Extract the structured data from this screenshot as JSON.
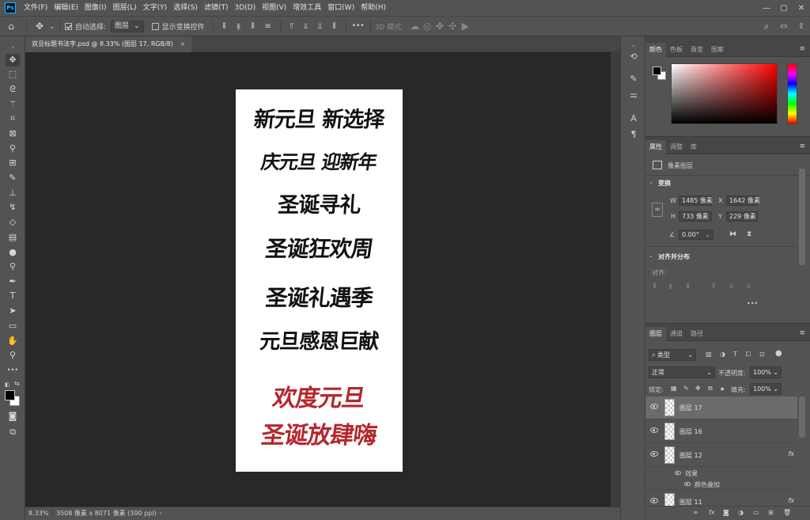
{
  "menu": [
    "文件(F)",
    "编辑(E)",
    "图像(I)",
    "图层(L)",
    "文字(Y)",
    "选择(S)",
    "滤镜(T)",
    "3D(D)",
    "视图(V)",
    "增效工具",
    "窗口(W)",
    "帮助(H)"
  ],
  "app_logo": "Ps",
  "window_controls": [
    "—",
    "▢",
    "✕"
  ],
  "options": {
    "auto_select_label": "自动选择:",
    "auto_select_value": "图层",
    "show_transform_label": "显示变换控件",
    "mode_3d_label": "3D 模式:",
    "more": "•••"
  },
  "document": {
    "tab_title": "双旦标题书法字.psd @ 8.33% (图层 17, RGB/8)",
    "close": "×",
    "lines": [
      {
        "text": "新元旦 新选择",
        "color": "#111111"
      },
      {
        "text": "庆元旦 迎新年",
        "color": "#111111"
      },
      {
        "text": "圣诞寻礼",
        "color": "#111111"
      },
      {
        "text": "圣诞狂欢周",
        "color": "#111111"
      },
      {
        "text": "圣诞礼遇季",
        "color": "#111111"
      },
      {
        "text": "元旦感恩巨献",
        "color": "#111111"
      },
      {
        "text": "欢度元旦",
        "color": "#b3282d"
      },
      {
        "text": "圣诞放肆嗨",
        "color": "#b3282d"
      }
    ]
  },
  "status": {
    "zoom": "8.33%",
    "info": "3508 像素 x 8071 像素 (300 ppi)",
    "arrow": "›"
  },
  "color_panel": {
    "tabs": [
      "颜色",
      "色板",
      "渐变",
      "图案"
    ],
    "fg": "#000000",
    "bg": "#ffffff"
  },
  "props_panel": {
    "tabs": [
      "属性",
      "调整",
      "库"
    ],
    "layer_type": "像素图层",
    "transform_title": "变换",
    "w_label": "W",
    "w_value": "1485 像素",
    "x_label": "X",
    "x_value": "1642 像素",
    "h_label": "H",
    "h_value": "733 像素",
    "y_label": "Y",
    "y_value": "229 像素",
    "angle_value": "0.00°",
    "align_title": "对齐并分布",
    "align_label": "对齐:",
    "more": "•••"
  },
  "layers_panel": {
    "tabs": [
      "图层",
      "通道",
      "路径"
    ],
    "filter_kind": "类型",
    "blend_mode": "正常",
    "opacity_label": "不透明度:",
    "opacity_value": "100%",
    "lock_label": "锁定:",
    "fill_label": "填充:",
    "fill_value": "100%",
    "layers": [
      {
        "name": "图层 17",
        "selected": true,
        "fx": ""
      },
      {
        "name": "图层 16",
        "selected": false,
        "fx": ""
      },
      {
        "name": "图层 12",
        "selected": false,
        "fx": "fx"
      }
    ],
    "effects_label": "效果",
    "effect_name": "颜色叠加",
    "partial_layer": "图层 11",
    "partial_fx": "fx",
    "footer_fx": "fx"
  }
}
